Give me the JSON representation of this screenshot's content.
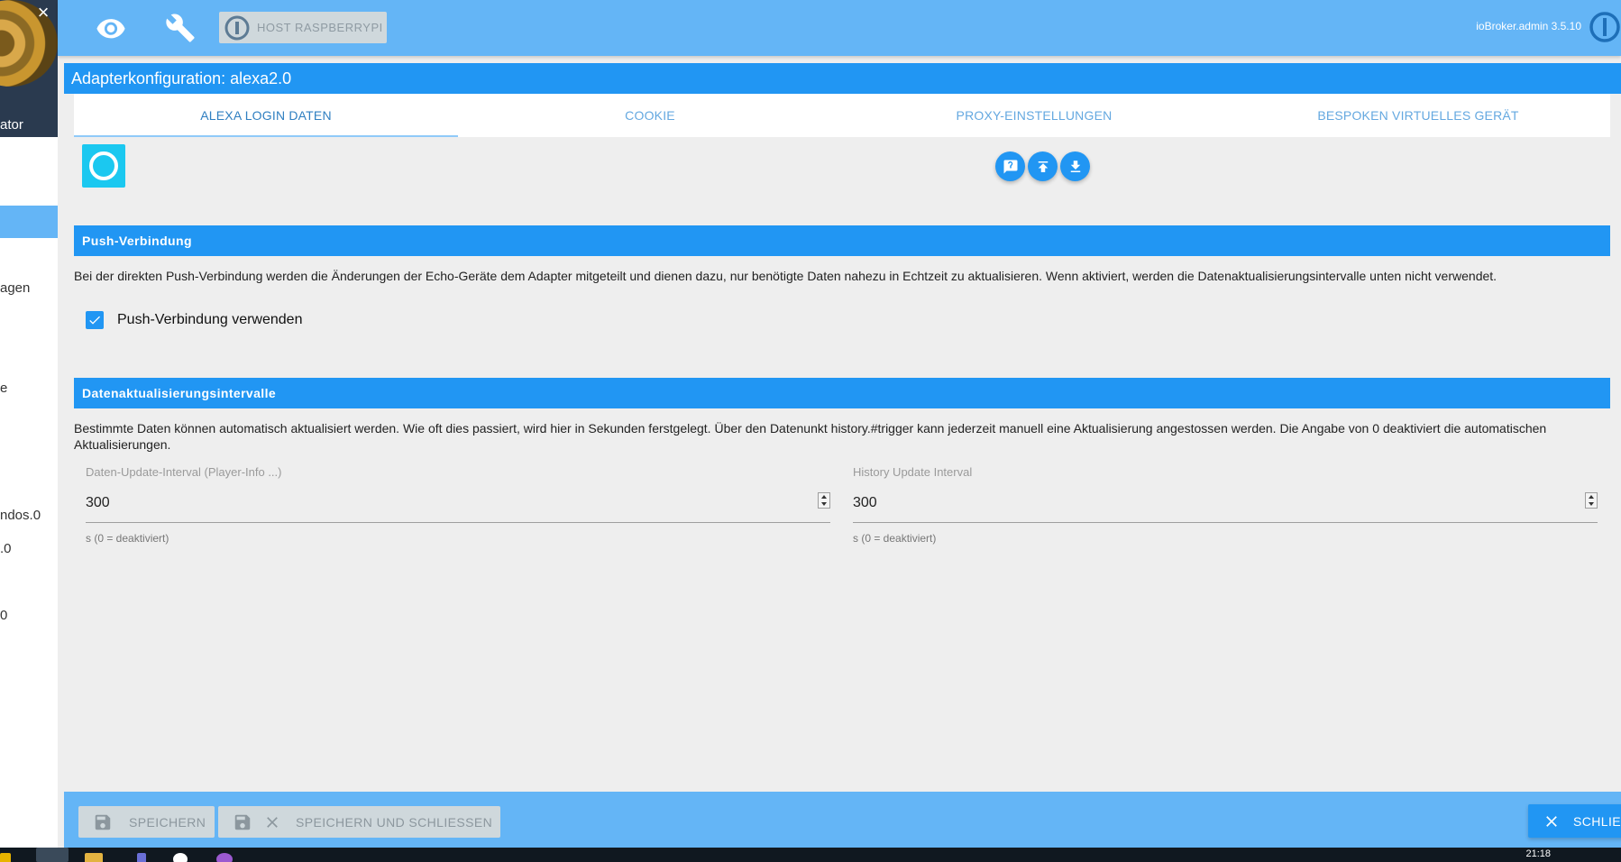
{
  "sidebar": {
    "user_label": "ator",
    "items": [
      {
        "label": "agen",
        "active": false
      },
      {
        "label": "e",
        "active": false
      },
      {
        "label": "ndos.0",
        "active": false
      },
      {
        "label": ".0",
        "active": false
      },
      {
        "label": "0",
        "active": false
      }
    ]
  },
  "topbar": {
    "icons": [
      "eye-icon",
      "wrench-icon"
    ],
    "host_label": "HOST RASPBERRYPI",
    "version": "ioBroker.admin 3.5.10"
  },
  "config": {
    "title": "Adapterkonfiguration: alexa2.0",
    "tabs": [
      {
        "label": "ALEXA LOGIN DATEN",
        "active": true
      },
      {
        "label": "COOKIE",
        "active": false
      },
      {
        "label": "PROXY-EINSTELLUNGEN",
        "active": false
      },
      {
        "label": "BESPOKEN VIRTUELLES GERÄT",
        "active": false
      }
    ],
    "action_icons": [
      "help-icon",
      "upload-icon",
      "download-icon"
    ]
  },
  "push": {
    "heading": "Push-Verbindung",
    "description": "Bei der direkten Push-Verbindung werden die Änderungen der Echo-Geräte dem Adapter mitgeteilt und dienen dazu, nur benötigte Daten nahezu in Echtzeit zu aktualisieren. Wenn aktiviert, werden die Datenaktualisierungsintervalle unten nicht verwendet.",
    "checkbox_label": "Push-Verbindung verwenden",
    "checked": true
  },
  "intervals": {
    "heading": "Datenaktualisierungsintervalle",
    "description": "Bestimmte Daten können automatisch aktualisiert werden. Wie oft dies passiert, wird hier in Sekunden ferstgelegt. Über den Datenunkt history.#trigger kann jederzeit manuell eine Aktualisierung angestossen werden. Die Angabe von 0 deaktiviert die automatischen Aktualisierungen.",
    "fields": [
      {
        "label": "Daten-Update-Interval (Player-Info ...)",
        "value": "300",
        "help": "s (0 = deaktiviert)"
      },
      {
        "label": "History Update Interval",
        "value": "300",
        "help": "s (0 = deaktiviert)"
      }
    ]
  },
  "footer": {
    "save_label": "SPEICHERN",
    "save_close_label": "SPEICHERN UND SCHLIESSEN",
    "close_label": "SCHLIESSEN"
  },
  "taskbar": {
    "clock": "21:18"
  },
  "colors": {
    "primary": "#2196f3",
    "bar": "#64b5f6",
    "background": "#eeeeee",
    "alexa": "#1bc8f0"
  }
}
